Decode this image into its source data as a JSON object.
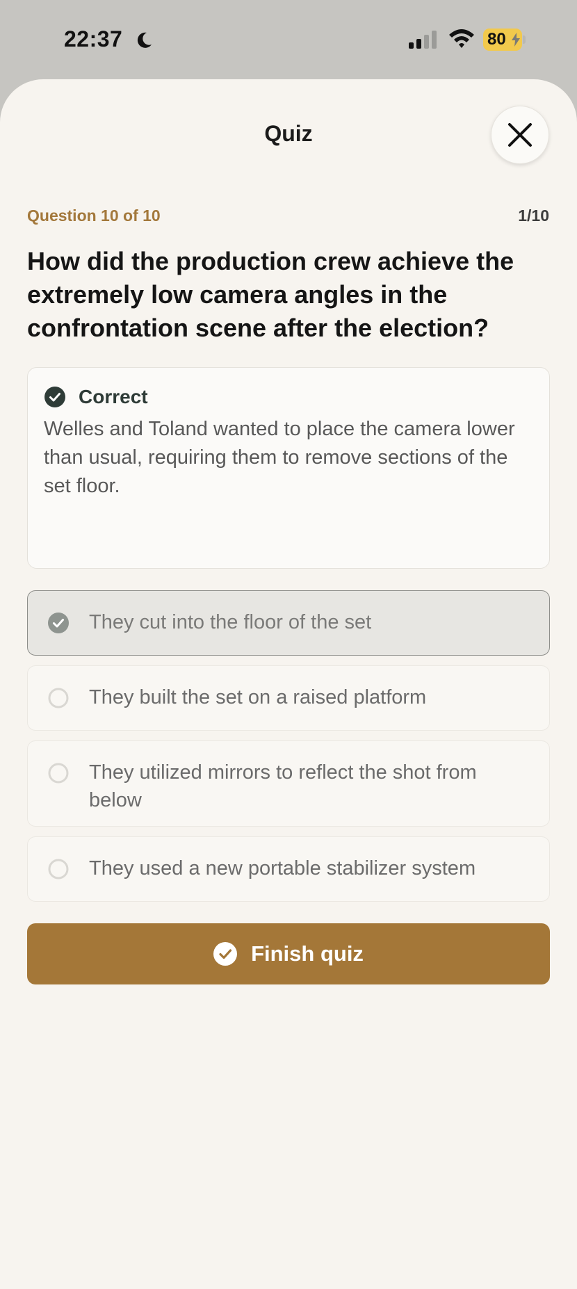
{
  "status_bar": {
    "time": "22:37",
    "battery": "80",
    "icons": [
      "moon-icon",
      "cellular-signal-icon",
      "wifi-icon",
      "battery-icon",
      "bolt-icon"
    ]
  },
  "header": {
    "title": "Quiz",
    "close_icon": "close-icon"
  },
  "quiz": {
    "question_label": "Question 10 of 10",
    "progress": "1/10",
    "question": "How did the production crew achieve the extremely low camera angles in the confrontation scene after the election?"
  },
  "feedback": {
    "status": "Correct",
    "explanation": "Welles and Toland wanted to place the camera lower than usual, requiring them to remove sections of the set floor."
  },
  "options": [
    {
      "label": "They cut into the floor of the set",
      "selected": true
    },
    {
      "label": "They built the set on a raised platform",
      "selected": false
    },
    {
      "label": "They utilized mirrors to reflect the shot from below",
      "selected": false
    },
    {
      "label": "They used a new portable stabilizer system",
      "selected": false
    }
  ],
  "actions": {
    "finish_label": "Finish quiz"
  },
  "colors": {
    "accent": "#a47738",
    "correct": "#2e3b37",
    "sheet": "#f7f4ef"
  }
}
